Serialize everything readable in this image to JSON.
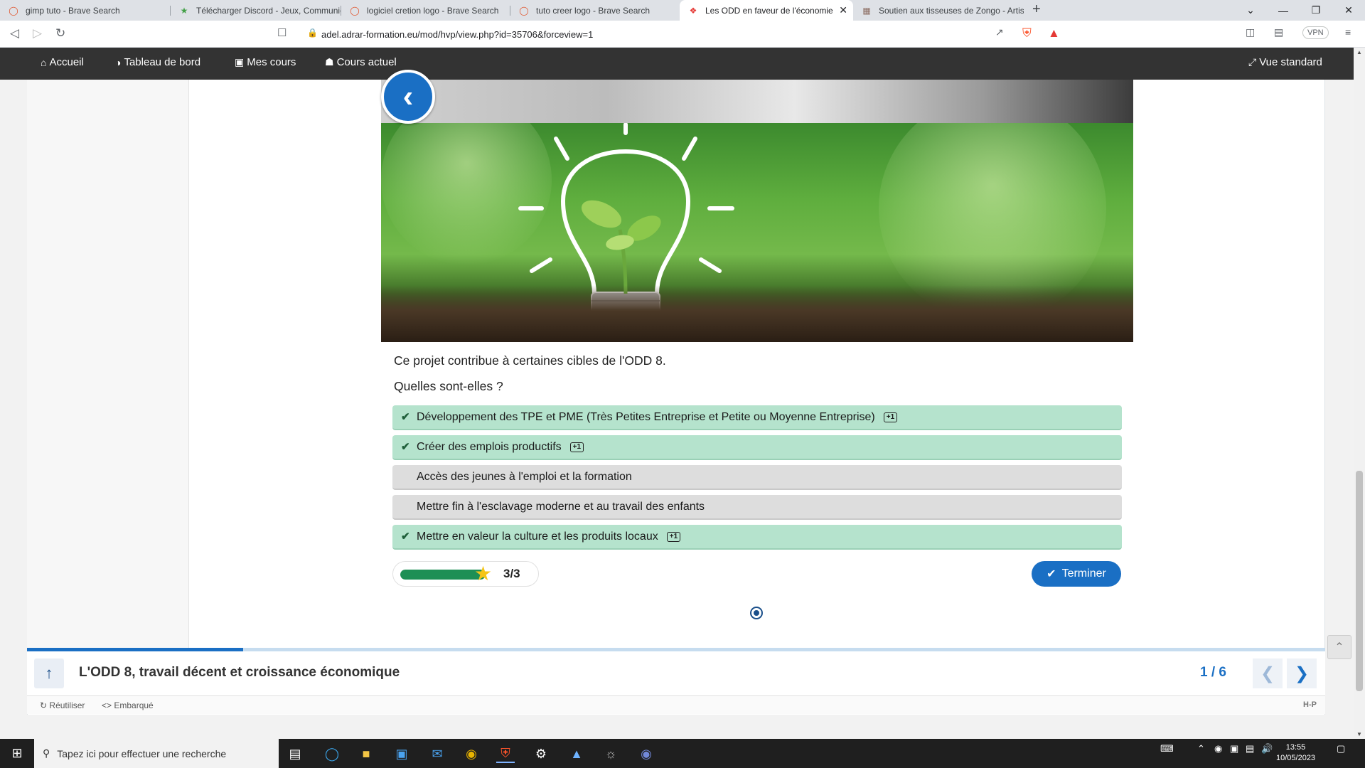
{
  "browser": {
    "tabs": [
      {
        "title": "gimp tuto - Brave Search",
        "icon": "brave-search-icon"
      },
      {
        "title": "Télécharger Discord - Jeux, Communic",
        "icon": "discord-icon"
      },
      {
        "title": "logiciel cretion logo - Brave Search",
        "icon": "brave-search-icon"
      },
      {
        "title": "tuto creer logo - Brave Search",
        "icon": "brave-search-icon"
      },
      {
        "title": "Les ODD en faveur de l'économie",
        "icon": "odd-icon",
        "active": true
      },
      {
        "title": "Soutien aux tisseuses de Zongo - Artis",
        "icon": "page-icon"
      }
    ],
    "url": "adel.adrar-formation.eu/mod/hvp/view.php?id=35706&forceview=1",
    "vpn_label": "VPN"
  },
  "navbar": {
    "items": [
      "Accueil",
      "Tableau de bord",
      "Mes cours",
      "Cours actuel"
    ],
    "right": "Vue standard"
  },
  "quiz": {
    "question_line1": "Ce projet contribue à certaines cibles de l'ODD 8.",
    "question_line2": "Quelles sont-elles ?",
    "answers": [
      {
        "text": "Développement des TPE et PME (Très Petites Entreprise et Petite ou Moyenne Entreprise)",
        "correct": true,
        "points": "+1"
      },
      {
        "text": "Créer des emplois productifs",
        "correct": true,
        "points": "+1"
      },
      {
        "text": "Accès des jeunes à l'emploi et la formation",
        "correct": false
      },
      {
        "text": "Mettre fin à l'esclavage moderne et au travail des enfants",
        "correct": false
      },
      {
        "text": "Mettre en valeur la culture et les produits locaux",
        "correct": true,
        "points": "+1"
      }
    ],
    "score": "3/3",
    "score_progress": 1.0,
    "finish_label": "Terminer"
  },
  "footer": {
    "title": "L'ODD 8, travail décent et croissance économique",
    "pager": "1 / 6",
    "progress": 0.1667,
    "reuse_label": "Réutiliser",
    "embed_label": "Embarqué",
    "hp_label": "H-P"
  },
  "taskbar": {
    "search_placeholder": "Tapez ici pour effectuer une recherche",
    "time": "13:55",
    "date": "10/05/2023"
  },
  "colors": {
    "accent": "#1a6fc4",
    "correct_bg": "#b5e3cd",
    "incorrect_bg": "#dddddd",
    "nav_bg": "#333333"
  }
}
